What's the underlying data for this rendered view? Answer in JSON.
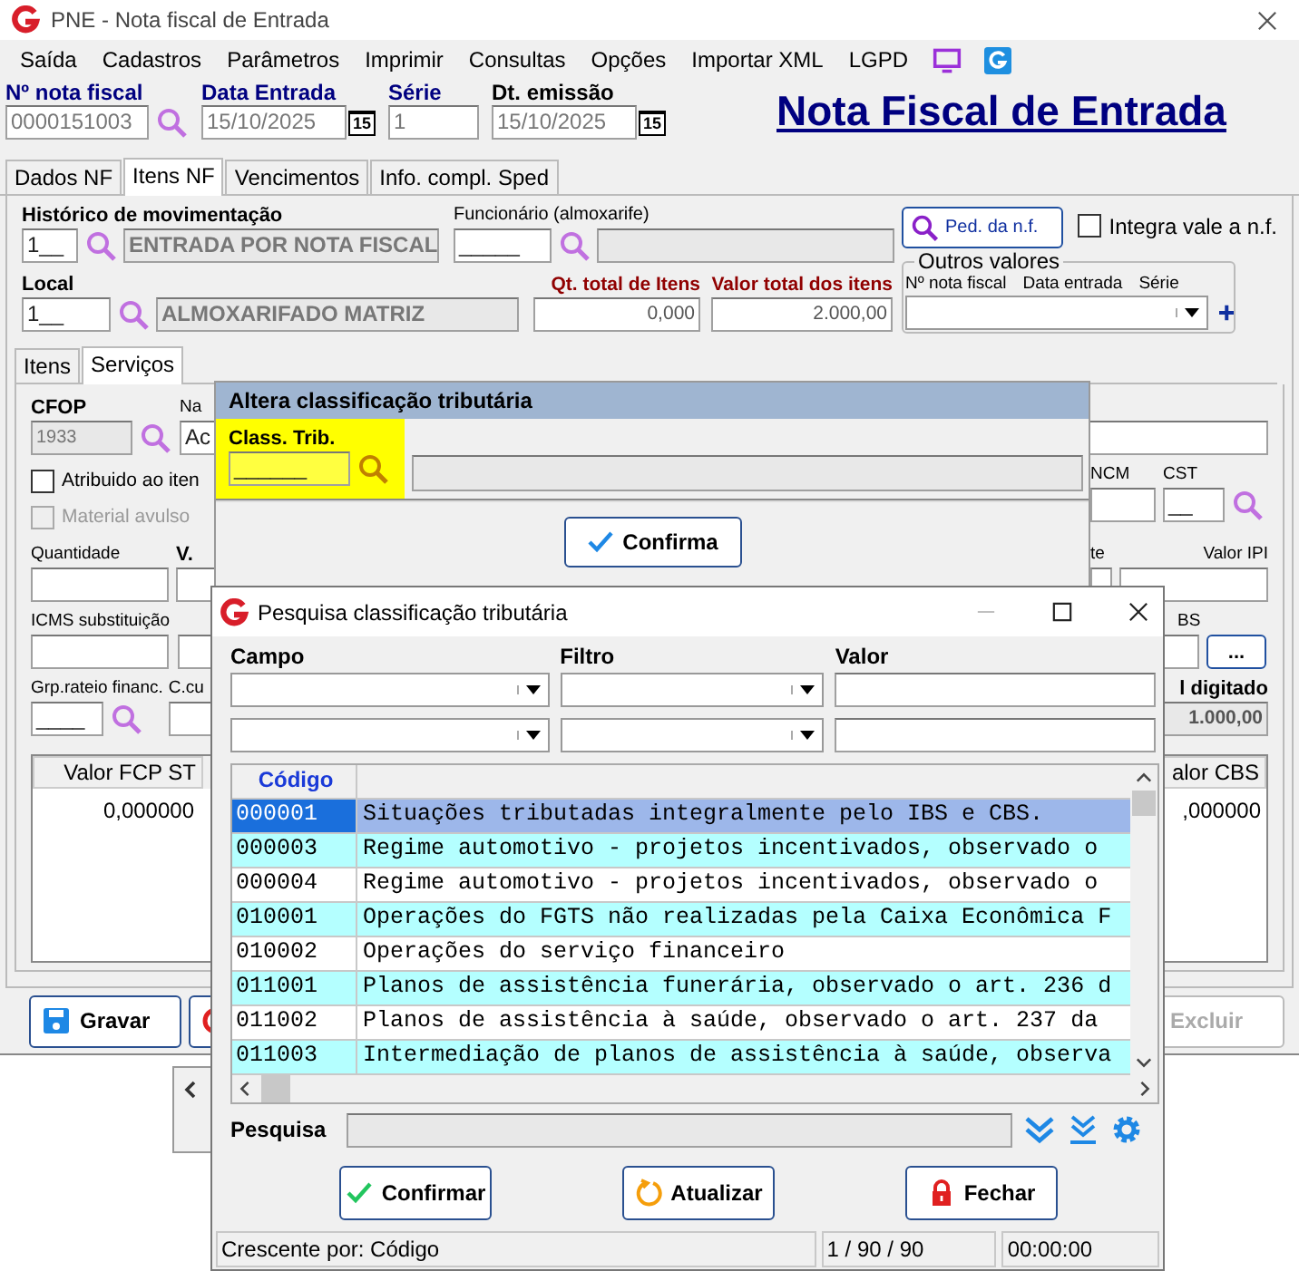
{
  "window": {
    "title": "PNE - Nota fiscal de Entrada"
  },
  "menu": [
    "Saída",
    "Cadastros",
    "Parâmetros",
    "Imprimir",
    "Consultas",
    "Opções",
    "Importar XML",
    "LGPD"
  ],
  "header": {
    "fields": [
      {
        "label": "Nº nota fiscal",
        "value": "0000151003",
        "kind": "search",
        "color": "#000080"
      },
      {
        "label": "Data Entrada",
        "value": "15/10/2025",
        "kind": "date",
        "calendar": "15",
        "color": "#000080"
      },
      {
        "label": "Série",
        "value": "1",
        "kind": "plain",
        "color": "#000080"
      },
      {
        "label": "Dt. emissão",
        "value": "15/10/2025",
        "kind": "date",
        "calendar": "15",
        "color": "#000000"
      }
    ],
    "title": "Nota Fiscal de Entrada"
  },
  "tabs": [
    {
      "label": "Dados NF",
      "selected": false
    },
    {
      "label": "Itens NF",
      "selected": true
    },
    {
      "label": "Vencimentos",
      "selected": false
    },
    {
      "label": "Info. compl. Sped",
      "selected": false
    }
  ],
  "movement": {
    "historico": {
      "label": "Histórico de movimentação",
      "code": "1__",
      "description": "ENTRADA POR NOTA FISCAL"
    },
    "funcionario": {
      "label": "Funcionário (almoxarife)",
      "code": "_____"
    },
    "ped_button": "Ped. da n.f.",
    "integra": {
      "label": "Integra vale a n.f.",
      "checked": false
    },
    "local": {
      "label": "Local",
      "code": "1__",
      "description": "ALMOXARIFADO MATRIZ"
    },
    "totals": [
      {
        "label": "Qt. total de Itens",
        "value": "0,000"
      },
      {
        "label": "Valor total dos itens",
        "value": "2.000,00"
      }
    ],
    "outros": {
      "legend": "Outros valores",
      "columns": [
        "Nº nota fiscal",
        "Data entrada",
        "Série"
      ]
    }
  },
  "subtabs": [
    {
      "label": "Itens",
      "selected": false
    },
    {
      "label": "Serviços",
      "selected": true
    }
  ],
  "services": {
    "cfop_label": "CFOP",
    "cfop_value": "1933",
    "na_label": "Na",
    "na_value": "Ac",
    "ncm_label": "NCM",
    "cst_label": "CST",
    "cst_value": "__",
    "checks": [
      {
        "label": "Atribuido ao iten",
        "checked": false,
        "disabled": false
      },
      {
        "label": "Material avulso",
        "checked": false,
        "disabled": true
      }
    ],
    "quantidade_label": "Quantidade",
    "v_label": "V.",
    "te_label": "te",
    "ipi_label": "Valor IPI",
    "icms_label": "ICMS substituição",
    "bs_label": "BS",
    "more_button": "...",
    "grp_label": "Grp.rateio financ.",
    "grp_value": "____",
    "ccu_label": "C.cu",
    "digitado_label": "l digitado",
    "digitado_value": "1.000,00",
    "grid_left_header": "Valor FCP ST",
    "grid_left_value": "0,000000",
    "grid_right_header": "alor CBS",
    "grid_right_value": ",000000"
  },
  "buttons": [
    {
      "label": "Gravar",
      "kind": "save",
      "disabled": false
    },
    {
      "kind": "cancel",
      "disabled": false
    },
    {
      "label": "Excluir",
      "kind": "delete",
      "disabled": true
    }
  ],
  "dialog_altera": {
    "title": "Altera classificação tributária",
    "field_label": "Class. Trib.",
    "code": "______",
    "button": "Confirma"
  },
  "dialog_pesquisa": {
    "title": "Pesquisa classificação tributária",
    "filter_labels": [
      "Campo",
      "Filtro",
      "Valor"
    ],
    "grid": {
      "column": "Código",
      "rows": [
        {
          "code": "000001",
          "description": "Situações tributadas integralmente pelo IBS e CBS.",
          "selected": true
        },
        {
          "code": "000003",
          "description": "Regime automotivo - projetos incentivados, observado o",
          "selected": false
        },
        {
          "code": "000004",
          "description": "Regime automotivo - projetos incentivados, observado o",
          "selected": false
        },
        {
          "code": "010001",
          "description": "Operações do FGTS não realizadas pela Caixa Econômica F",
          "selected": false
        },
        {
          "code": "010002",
          "description": "Operações do serviço financeiro",
          "selected": false
        },
        {
          "code": "011001",
          "description": "Planos de assistência funerária, observado o art. 236 d",
          "selected": false
        },
        {
          "code": "011002",
          "description": "Planos de assistência à saúde, observado o art. 237 da",
          "selected": false
        },
        {
          "code": "011003",
          "description": "Intermediação de planos de assistência à saúde, observa",
          "selected": false
        }
      ]
    },
    "search_label": "Pesquisa",
    "buttons": [
      {
        "label": "Confirmar",
        "kind": "confirm"
      },
      {
        "label": "Atualizar",
        "kind": "refresh"
      },
      {
        "label": "Fechar",
        "kind": "close"
      }
    ],
    "status": [
      "Crescente por: Código",
      "1 / 90 / 90",
      "00:00:00"
    ]
  }
}
